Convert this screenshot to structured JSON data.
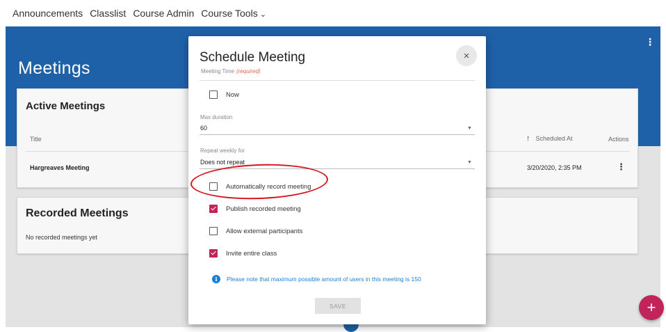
{
  "nav": {
    "items": [
      "Announcements",
      "Classlist",
      "Course Admin",
      "Course Tools"
    ],
    "dropdown_icon": "chevron-down-icon"
  },
  "page": {
    "title": "Meetings",
    "kebab_icon": "more-vert-icon"
  },
  "active_meetings": {
    "title": "Active Meetings",
    "columns": {
      "title": "Title",
      "scheduled_at": "Scheduled At",
      "actions": "Actions",
      "sort_icon": "arrow-up-icon"
    },
    "rows": [
      {
        "title": "Hargreaves Meeting",
        "scheduled_at": "3/20/2020, 2:35 PM",
        "action_icon": "more-vert-icon"
      }
    ]
  },
  "recorded_meetings": {
    "title": "Recorded Meetings",
    "empty_message": "No recorded meetings yet"
  },
  "fab": {
    "label": "+",
    "icon": "add-icon",
    "color": "#c0245b"
  },
  "modal": {
    "title": "Schedule Meeting",
    "close_icon": "close-icon",
    "close_glyph": "×",
    "meeting_time_label": "Meeting Time",
    "required_text": "(required)",
    "now_label": "Now",
    "now_checked": false,
    "max_duration_label": "Max duration",
    "max_duration_value": "60",
    "repeat_label": "Repeat weekly for",
    "repeat_value": "Does not repeat",
    "options": [
      {
        "label": "Automatically record meeting",
        "checked": false
      },
      {
        "label": "Publish recorded meeting",
        "checked": true
      },
      {
        "label": "Allow external participants",
        "checked": false
      },
      {
        "label": "Invite entire class",
        "checked": true
      }
    ],
    "info_icon": "info-icon",
    "info_text": "Please note that maximum possible amount of users in this meeting is 150",
    "save_label": "SAVE"
  },
  "colors": {
    "brand_blue": "#1f61a8",
    "accent_magenta": "#c0245b",
    "info_blue": "#1a7fd4",
    "annotation_red": "#d4171e"
  }
}
